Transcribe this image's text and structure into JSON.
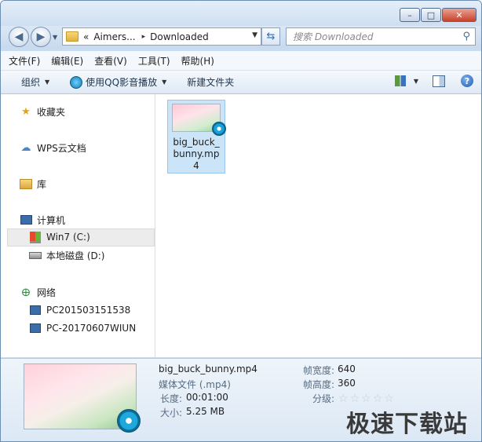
{
  "window": {
    "controls": {
      "minimize": "–",
      "maximize": "□",
      "close": "✕"
    }
  },
  "address": {
    "prefix": "«",
    "parent": "Aimers...",
    "sep": "▸",
    "current": "Downloaded"
  },
  "search": {
    "placeholder": "搜索 Downloaded"
  },
  "menu": [
    "文件(F)",
    "编辑(E)",
    "查看(V)",
    "工具(T)",
    "帮助(H)"
  ],
  "toolbar": {
    "organize": "组织",
    "play_with_qq": "使用QQ影音播放",
    "new_folder": "新建文件夹"
  },
  "sidebar": {
    "favorites": "收藏夹",
    "wps": "WPS云文档",
    "library": "库",
    "computer": "计算机",
    "drive_c": "Win7 (C:)",
    "drive_d": "本地磁盘 (D:)",
    "network": "网络",
    "pc1": "PC201503151538",
    "pc2": "PC-20170607WIUN"
  },
  "file": {
    "name": "big_buck_bunny.mp4"
  },
  "details": {
    "name": "big_buck_bunny.mp4",
    "type": "媒体文件 (.mp4)",
    "length_label": "长度:",
    "length": "00:01:00",
    "size_label": "大小:",
    "size": "5.25 MB",
    "width_label": "帧宽度:",
    "width": "640",
    "height_label": "帧高度:",
    "height": "360",
    "rating_label": "分级:",
    "rating": 0,
    "rating_max": 5
  },
  "watermark": "极速下载站",
  "icons": {
    "back": "back-arrow-icon",
    "forward": "forward-arrow-icon",
    "refresh": "refresh-icon",
    "search": "magnifier-icon"
  }
}
